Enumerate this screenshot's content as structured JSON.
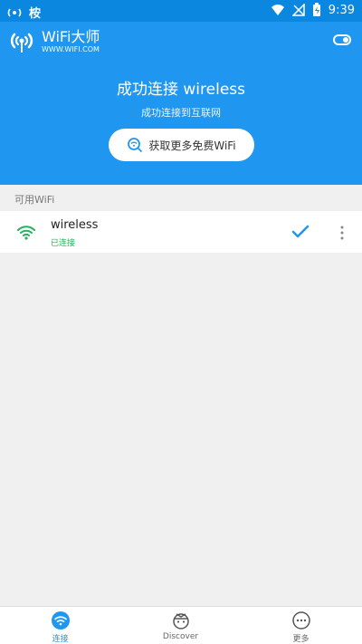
{
  "status_bar": {
    "left_label": "桉",
    "time": "9:39"
  },
  "header": {
    "app_name": "WiFi大师",
    "app_url": "WWW.WIFI.COM",
    "title": "成功连接 wireless",
    "subtitle": "成功连接到互联网",
    "cta_label": "获取更多免费WiFi",
    "toggle_state": "on"
  },
  "available": {
    "section_label": "可用WiFi",
    "items": [
      {
        "name": "wireless",
        "status": "已连接"
      }
    ]
  },
  "tabs": [
    {
      "label": "连接",
      "icon": "wifi-icon",
      "active": true
    },
    {
      "label": "Discover",
      "icon": "discover-icon",
      "active": false
    },
    {
      "label": "更多",
      "icon": "more-dots-icon",
      "active": false
    }
  ],
  "colors": {
    "primary": "#1f97f0",
    "status_bar": "#0c87e0",
    "success": "#24b35a"
  }
}
